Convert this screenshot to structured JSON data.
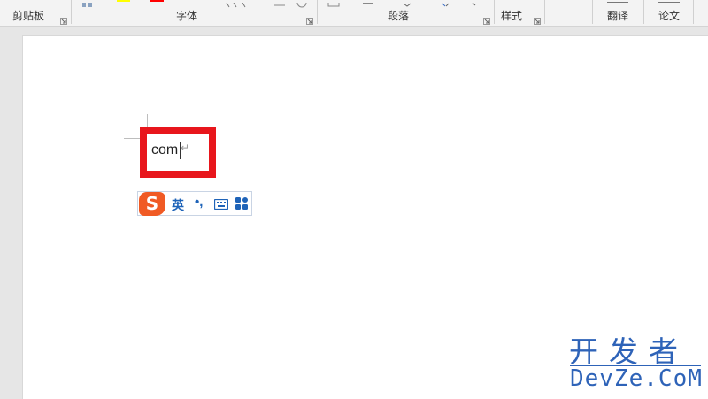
{
  "ribbon": {
    "groups": {
      "clipboard": "剪贴板",
      "font": "字体",
      "paragraph": "段落",
      "styles": "样式",
      "translate": "翻译",
      "paper": "论文"
    },
    "colors": {
      "highlight_swatch": "#ffff00",
      "font_color_swatch": "#ff0000"
    }
  },
  "document": {
    "text": "com",
    "paragraph_mark": "↵",
    "highlight_color": "#e8161c"
  },
  "ime": {
    "logo": "S",
    "lang": "英",
    "punct": "•,",
    "keyboard_icon": "keyboard-icon",
    "menu_icon": "grid-menu-icon",
    "brand_color": "#f05a24"
  },
  "watermark": {
    "chinese": "开发者",
    "english": "DevZe.CoM",
    "color": "#2e63b8"
  }
}
